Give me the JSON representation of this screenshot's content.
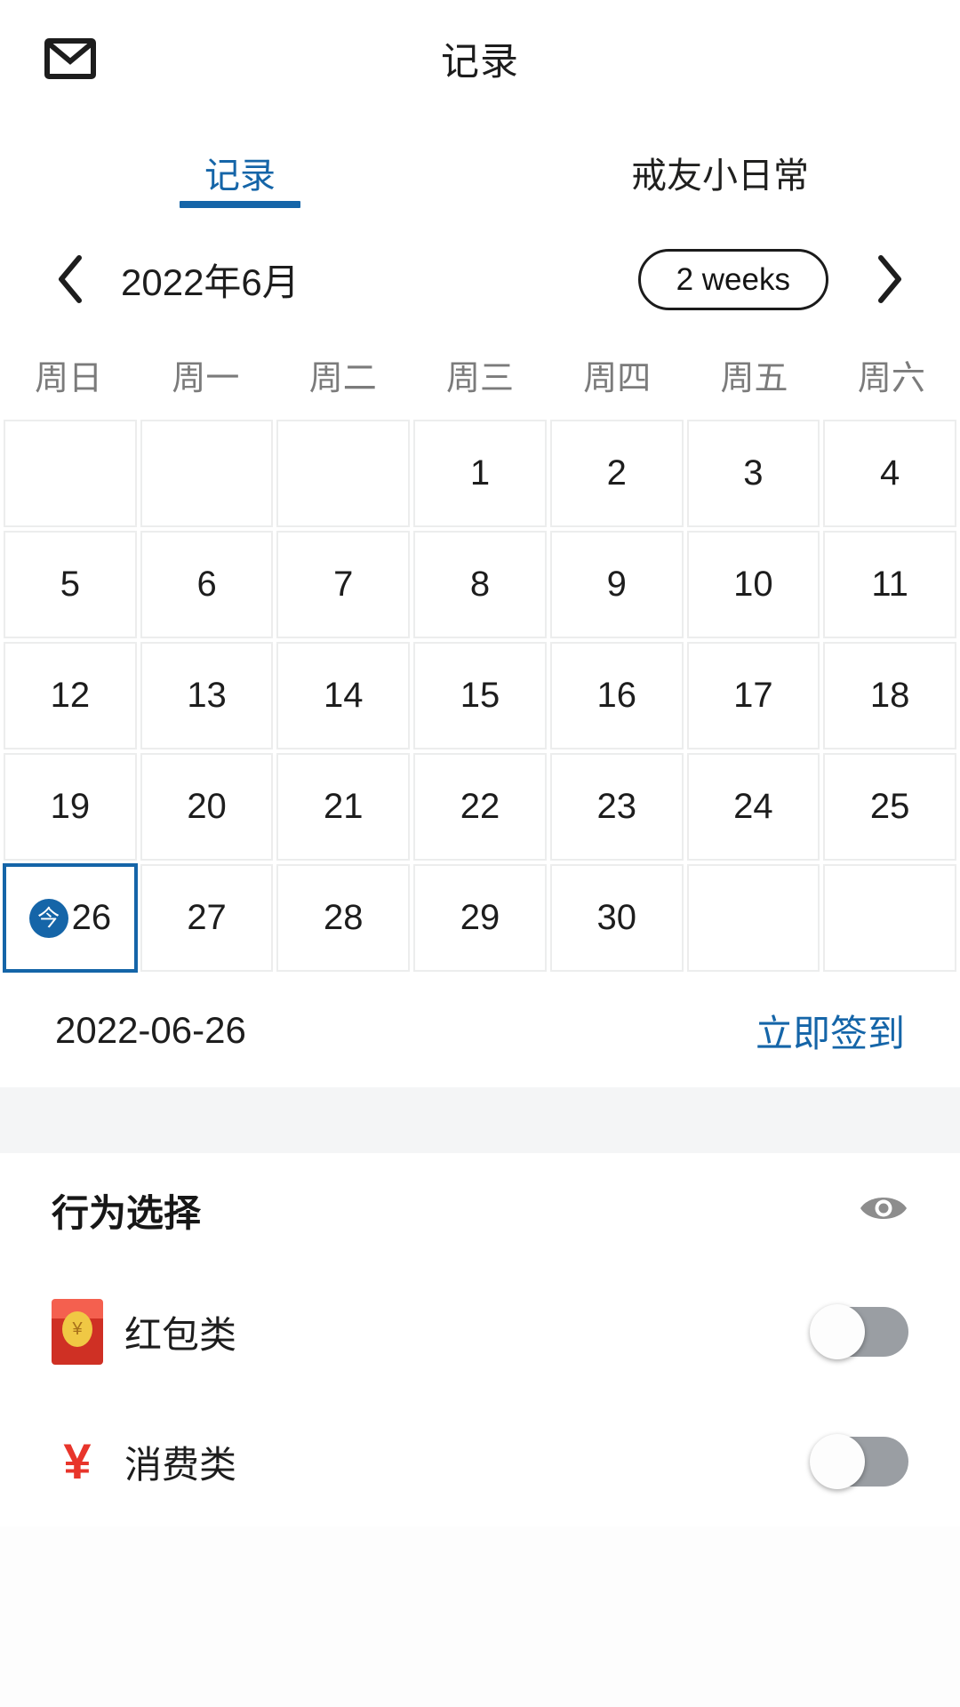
{
  "header": {
    "title": "记录",
    "mail_icon": "mail-envelope-icon"
  },
  "tabs": [
    {
      "label": "记录",
      "active": true
    },
    {
      "label": "戒友小日常",
      "active": false
    }
  ],
  "calendar_nav": {
    "prev_icon": "chevron-left-icon",
    "month_label": "2022年6月",
    "range_toggle_label": "2 weeks",
    "next_icon": "chevron-right-icon"
  },
  "weekdays": [
    "周日",
    "周一",
    "周二",
    "周三",
    "周四",
    "周五",
    "周六"
  ],
  "calendar": {
    "year": 2022,
    "month": 6,
    "today_badge": "今",
    "today_day": 26,
    "weeks": [
      [
        "",
        "",
        "",
        "1",
        "2",
        "3",
        "4"
      ],
      [
        "5",
        "6",
        "7",
        "8",
        "9",
        "10",
        "11"
      ],
      [
        "12",
        "13",
        "14",
        "15",
        "16",
        "17",
        "18"
      ],
      [
        "19",
        "20",
        "21",
        "22",
        "23",
        "24",
        "25"
      ],
      [
        "26",
        "27",
        "28",
        "29",
        "30",
        "",
        ""
      ]
    ]
  },
  "selected_date": {
    "date_text": "2022-06-26",
    "checkin_label": "立即签到"
  },
  "behavior_section": {
    "title": "行为选择",
    "eye_icon": "eye-icon",
    "items": [
      {
        "label": "红包类",
        "icon": "red-envelope-icon",
        "toggle_on": false
      },
      {
        "label": "消费类",
        "icon": "yuan-sign-icon",
        "toggle_on": false
      }
    ]
  },
  "colors": {
    "accent": "#1565a8",
    "toggle_off": "#9a9ea3",
    "cell_border": "#eceded",
    "muted_text": "#7b7b7b"
  }
}
